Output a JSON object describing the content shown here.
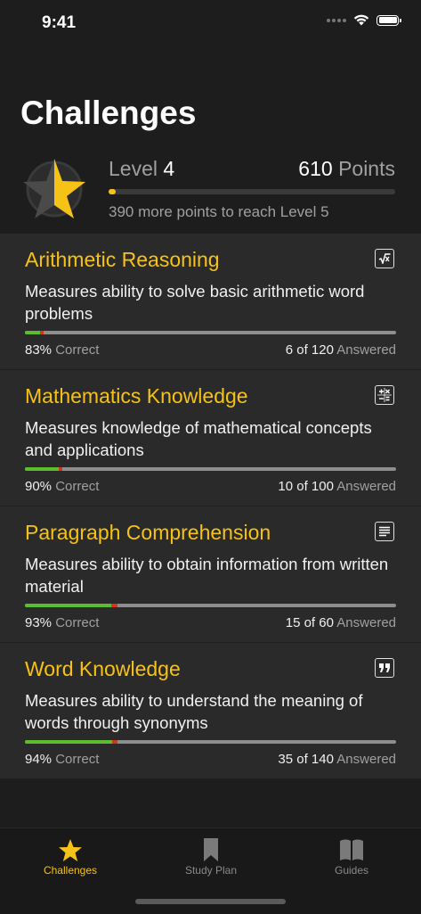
{
  "status_bar": {
    "time": "9:41"
  },
  "header": {
    "title": "Challenges"
  },
  "level": {
    "label": "Level",
    "value": "4",
    "points_value": "610",
    "points_label": "Points",
    "progress": 0.025,
    "hint": "390 more points to reach Level 5",
    "star_icon": "star-icon"
  },
  "challenges": [
    {
      "title": "Arithmetic Reasoning",
      "icon": "square-root-icon",
      "description": "Measures ability to solve basic arithmetic word problems",
      "percent": "83%",
      "correct_label": "Correct",
      "answered_count": "6 of 120",
      "answered_label": "Answered",
      "answered_fraction": 0.05,
      "correct_fraction": 0.83
    },
    {
      "title": "Mathematics Knowledge",
      "icon": "calculator-icon",
      "description": "Measures knowledge of mathematical concepts and applications",
      "percent": "90%",
      "correct_label": "Correct",
      "answered_count": "10 of 100",
      "answered_label": "Answered",
      "answered_fraction": 0.1,
      "correct_fraction": 0.9
    },
    {
      "title": "Paragraph Comprehension",
      "icon": "document-lines-icon",
      "description": "Measures ability to obtain information from written material",
      "percent": "93%",
      "correct_label": "Correct",
      "answered_count": "15 of 60",
      "answered_label": "Answered",
      "answered_fraction": 0.25,
      "correct_fraction": 0.93
    },
    {
      "title": "Word Knowledge",
      "icon": "quote-icon",
      "description": "Measures ability to understand the meaning of words through synonyms",
      "percent": "94%",
      "correct_label": "Correct",
      "answered_count": "35 of 140",
      "answered_label": "Answered",
      "answered_fraction": 0.25,
      "correct_fraction": 0.94
    }
  ],
  "tabs": [
    {
      "label": "Challenges",
      "icon": "star-icon",
      "active": true
    },
    {
      "label": "Study Plan",
      "icon": "bookmark-icon",
      "active": false
    },
    {
      "label": "Guides",
      "icon": "book-icon",
      "active": false
    }
  ],
  "colors": {
    "accent": "#f6c215",
    "correct": "#5cbd2e",
    "incorrect": "#d4351c",
    "background": "#1d1d1d",
    "card": "#2a2a2a"
  }
}
